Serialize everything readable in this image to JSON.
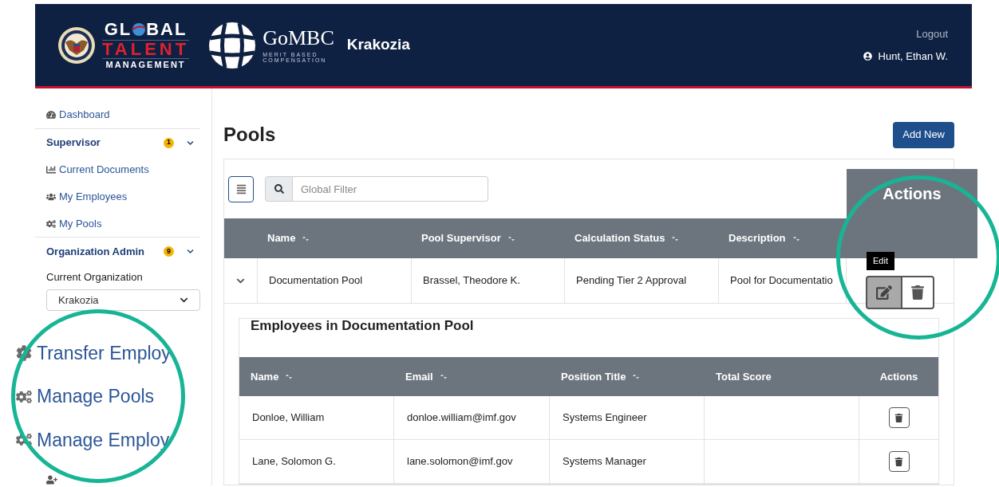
{
  "header": {
    "brand_top_start": "GL",
    "brand_top_end": "BAL",
    "brand_middle": "TALENT",
    "brand_bottom": "MANAGEMENT",
    "app_name": "GoMBC",
    "app_tagline_1": "MERIT BASED",
    "app_tagline_2": "COMPENSATION",
    "organization": "Krakozia",
    "logout": "Logout",
    "user": "Hunt, Ethan W."
  },
  "sidebar": {
    "items": [
      {
        "kind": "link",
        "label": "Dashboard"
      },
      {
        "kind": "section",
        "label": "Supervisor",
        "badge": "1",
        "expanded": true
      },
      {
        "kind": "link",
        "label": "Current Documents"
      },
      {
        "kind": "link",
        "label": "My Employees"
      },
      {
        "kind": "link",
        "label": "My Pools"
      },
      {
        "kind": "section",
        "label": "Organization Admin",
        "badge": "9",
        "expanded": true
      },
      {
        "kind": "label",
        "label": "Current Organization"
      },
      {
        "kind": "select",
        "label": "Krakozia"
      },
      {
        "kind": "big",
        "label": "Transfer Employ"
      },
      {
        "kind": "big",
        "label": "Manage Pools"
      },
      {
        "kind": "big",
        "label": "Manage Employ"
      },
      {
        "kind": "covered"
      }
    ]
  },
  "page": {
    "title": "Pools",
    "add_button": "Add New",
    "search": {
      "placeholder": "Global Filter"
    }
  },
  "table": {
    "columns": [
      {
        "label": "Name",
        "sortable": true
      },
      {
        "label": "Pool Supervisor",
        "sortable": true
      },
      {
        "label": "Calculation Status",
        "sortable": true
      },
      {
        "label": "Description",
        "sortable": true
      },
      {
        "label": "Actions",
        "sortable": false
      }
    ],
    "rows": [
      {
        "expanded": true,
        "cells": [
          "Documentation Pool",
          "Brassel, Theodore K.",
          "Pending Tier 2 Approval",
          "Pool for Documentatio"
        ],
        "tooltip": "Edit",
        "edit_hovered": true
      }
    ]
  },
  "subtable": {
    "title": "Employees in Documentation Pool",
    "columns": [
      {
        "label": "Name",
        "sortable": true
      },
      {
        "label": "Email",
        "sortable": true
      },
      {
        "label": "Position Title",
        "sortable": true
      },
      {
        "label": "Total Score",
        "sortable": false
      },
      {
        "label": "Actions",
        "sortable": false
      }
    ],
    "rows": [
      {
        "cells": [
          "Donloe, William",
          "donloe.william@imf.gov",
          "Systems Engineer",
          ""
        ]
      },
      {
        "cells": [
          "Lane, Solomon G.",
          "lane.solomon@imf.gov",
          "Systems Manager",
          ""
        ]
      }
    ]
  }
}
